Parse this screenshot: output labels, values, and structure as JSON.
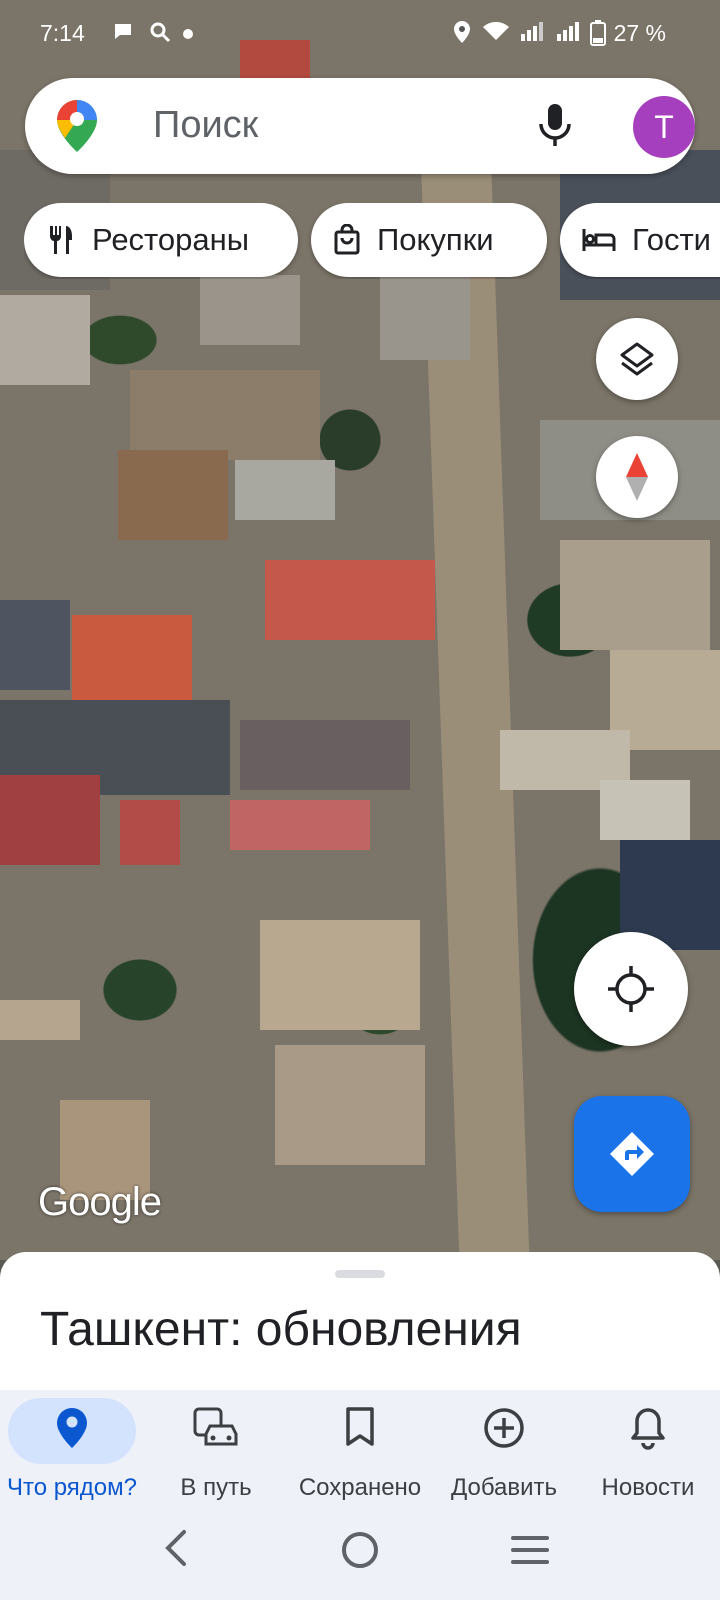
{
  "status_bar": {
    "time": "7:14",
    "battery": "27 %"
  },
  "search": {
    "placeholder": "Поиск",
    "avatar_letter": "T",
    "avatar_color": "#a63fbd"
  },
  "chips": [
    {
      "label": "Рестораны",
      "icon": "restaurant-icon"
    },
    {
      "label": "Покупки",
      "icon": "shopping-bag-icon"
    },
    {
      "label": "Гости",
      "icon": "hotel-bed-icon"
    }
  ],
  "map": {
    "attribution": "Google",
    "layers_icon": "layers-icon",
    "compass_icon": "compass-icon",
    "location_icon": "my-location-icon",
    "directions_icon": "directions-icon",
    "accent": "#1a73e8"
  },
  "sheet": {
    "title": "Ташкент: обновления"
  },
  "bottom_nav": {
    "items": [
      {
        "label": "Что рядом?",
        "icon": "location-pin-icon",
        "active": true
      },
      {
        "label": "В путь",
        "icon": "commute-icon",
        "active": false
      },
      {
        "label": "Сохранено",
        "icon": "bookmark-icon",
        "active": false
      },
      {
        "label": "Добавить",
        "icon": "add-circle-icon",
        "active": false
      },
      {
        "label": "Новости",
        "icon": "bell-icon",
        "active": false
      }
    ]
  },
  "system_nav": {
    "back_icon": "back-icon",
    "home_icon": "home-icon",
    "menu_icon": "recents-icon"
  }
}
